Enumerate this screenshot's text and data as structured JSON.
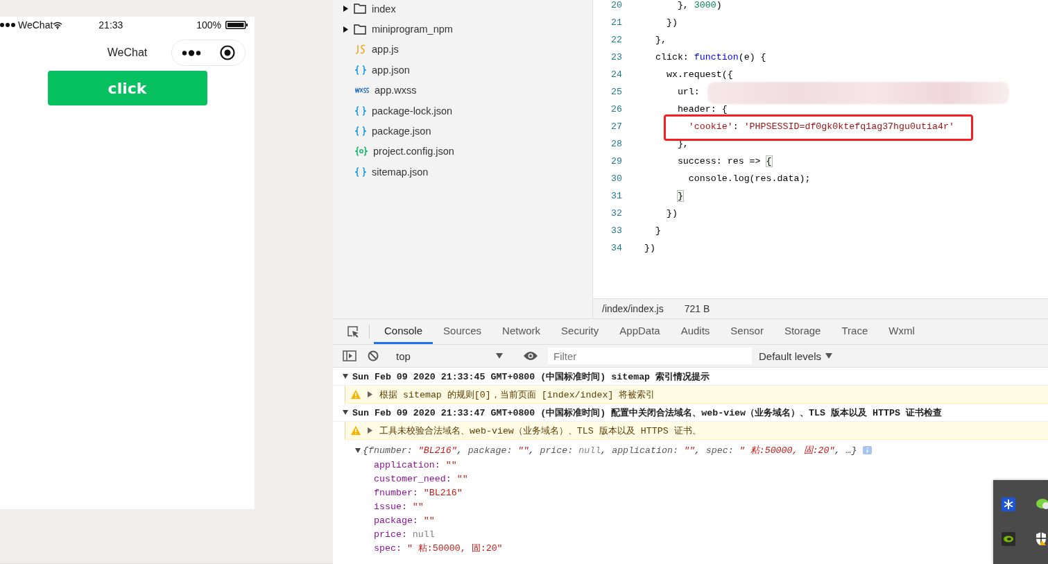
{
  "simulator": {
    "status_bar": {
      "carrier": "WeChat",
      "time": "21:33",
      "battery": "100%"
    },
    "nav_title": "WeChat",
    "button": "click"
  },
  "file_tree": [
    {
      "kind": "folder",
      "name": "index",
      "expanded": false
    },
    {
      "kind": "folder",
      "name": "miniprogram_npm",
      "expanded": false
    },
    {
      "kind": "js",
      "name": "app.js"
    },
    {
      "kind": "json",
      "name": "app.json"
    },
    {
      "kind": "wxss",
      "name": "app.wxss"
    },
    {
      "kind": "json",
      "name": "package-lock.json"
    },
    {
      "kind": "json",
      "name": "package.json"
    },
    {
      "kind": "config",
      "name": "project.config.json"
    },
    {
      "kind": "json",
      "name": "sitemap.json"
    }
  ],
  "editor": {
    "lines": [
      {
        "number": "20",
        "tokens": [
          {
            "kind": "plain",
            "text": "      }, "
          },
          {
            "kind": "number",
            "text": "3000"
          },
          {
            "kind": "plain",
            "text": ")"
          }
        ]
      },
      {
        "number": "21",
        "tokens": [
          {
            "kind": "plain",
            "text": "    })"
          }
        ]
      },
      {
        "number": "22",
        "tokens": [
          {
            "kind": "plain",
            "text": "  },"
          }
        ]
      },
      {
        "number": "23",
        "tokens": [
          {
            "kind": "plain",
            "text": "  click: "
          },
          {
            "kind": "keyword",
            "text": "function"
          },
          {
            "kind": "plain",
            "text": "(e) {"
          }
        ]
      },
      {
        "number": "24",
        "tokens": [
          {
            "kind": "plain",
            "text": "    wx.request({"
          }
        ]
      },
      {
        "number": "25",
        "tokens": [
          {
            "kind": "plain",
            "text": "      url:"
          }
        ]
      },
      {
        "number": "26",
        "tokens": [
          {
            "kind": "plain",
            "text": "      header: {"
          }
        ]
      },
      {
        "number": "27",
        "tokens": [
          {
            "kind": "string",
            "text": "        'cookie'"
          },
          {
            "kind": "plain",
            "text": ": "
          },
          {
            "kind": "string",
            "text": "'PHPSESSID=df0gk0ktefq1ag37hgu0utia4r'"
          }
        ]
      },
      {
        "number": "28",
        "tokens": [
          {
            "kind": "plain",
            "text": "      },"
          }
        ]
      },
      {
        "number": "29",
        "tokens": [
          {
            "kind": "plain",
            "text": "      success: res => "
          },
          {
            "kind": "bracket",
            "text": "{"
          }
        ]
      },
      {
        "number": "30",
        "tokens": [
          {
            "kind": "plain",
            "text": "        console.log(res.data);"
          }
        ]
      },
      {
        "number": "31",
        "tokens": [
          {
            "kind": "bracket",
            "text": "      }"
          }
        ]
      },
      {
        "number": "32",
        "tokens": [
          {
            "kind": "plain",
            "text": "    })"
          }
        ]
      },
      {
        "number": "33",
        "tokens": [
          {
            "kind": "plain",
            "text": "  }"
          }
        ]
      },
      {
        "number": "34",
        "tokens": [
          {
            "kind": "plain",
            "text": "})"
          }
        ]
      }
    ],
    "file_path": "/index/index.js",
    "file_size": "721 B"
  },
  "devtools": {
    "tabs": [
      {
        "label": "Console",
        "selected": true
      },
      {
        "label": "Sources",
        "selected": false
      },
      {
        "label": "Network",
        "selected": false
      },
      {
        "label": "Security",
        "selected": false
      },
      {
        "label": "AppData",
        "selected": false
      },
      {
        "label": "Audits",
        "selected": false
      },
      {
        "label": "Sensor",
        "selected": false
      },
      {
        "label": "Storage",
        "selected": false
      },
      {
        "label": "Trace",
        "selected": false
      },
      {
        "label": "Wxml",
        "selected": false
      }
    ],
    "context": "top",
    "filter": {
      "placeholder": "Filter"
    },
    "levels": "Default levels",
    "console": [
      {
        "kind": "group",
        "expanded": true,
        "text": "Sun Feb 09 2020 21:33:45 GMT+0800 (中国标准时间) sitemap 索引情况提示"
      },
      {
        "kind": "warning",
        "text": "根据 sitemap 的规则[0]，当前页面 [index/index] 将被索引"
      },
      {
        "kind": "group",
        "expanded": true,
        "text": "Sun Feb 09 2020 21:33:47 GMT+0800 (中国标准时间) 配置中关闭合法域名、web-view（业务域名）、TLS 版本以及 HTTPS 证书检查"
      },
      {
        "kind": "warning",
        "text": "工具未校验合法域名、web-view（业务域名）、TLS 版本以及 HTTPS 证书。"
      },
      {
        "kind": "object",
        "expanded": true,
        "summary": [
          {
            "kind": "punct",
            "text": "{"
          },
          {
            "kind": "key",
            "text": "fnumber: "
          },
          {
            "kind": "string",
            "text": "\"BL216\""
          },
          {
            "kind": "punct",
            "text": ", "
          },
          {
            "kind": "key",
            "text": "package: "
          },
          {
            "kind": "string",
            "text": "\"\""
          },
          {
            "kind": "punct",
            "text": ", "
          },
          {
            "kind": "key",
            "text": "price: "
          },
          {
            "kind": "null",
            "text": "null"
          },
          {
            "kind": "punct",
            "text": ", "
          },
          {
            "kind": "key",
            "text": "application: "
          },
          {
            "kind": "string",
            "text": "\"\""
          },
          {
            "kind": "punct",
            "text": ", "
          },
          {
            "kind": "key",
            "text": "spec: "
          },
          {
            "kind": "string",
            "text": "\" 粘:50000, 固:20\""
          },
          {
            "kind": "punct",
            "text": ", …}"
          }
        ],
        "properties": [
          {
            "key": "application:",
            "kind": "string",
            "value": "\"\""
          },
          {
            "key": "customer_need:",
            "kind": "string",
            "value": "\"\""
          },
          {
            "key": "fnumber:",
            "kind": "string",
            "value": "\"BL216\""
          },
          {
            "key": "issue:",
            "kind": "string",
            "value": "\"\""
          },
          {
            "key": "package:",
            "kind": "string",
            "value": "\"\""
          },
          {
            "key": "price:",
            "kind": "null",
            "value": "null"
          },
          {
            "key": "spec:",
            "kind": "string",
            "value": "\" 粘:50000, 固:20\""
          }
        ]
      }
    ]
  }
}
